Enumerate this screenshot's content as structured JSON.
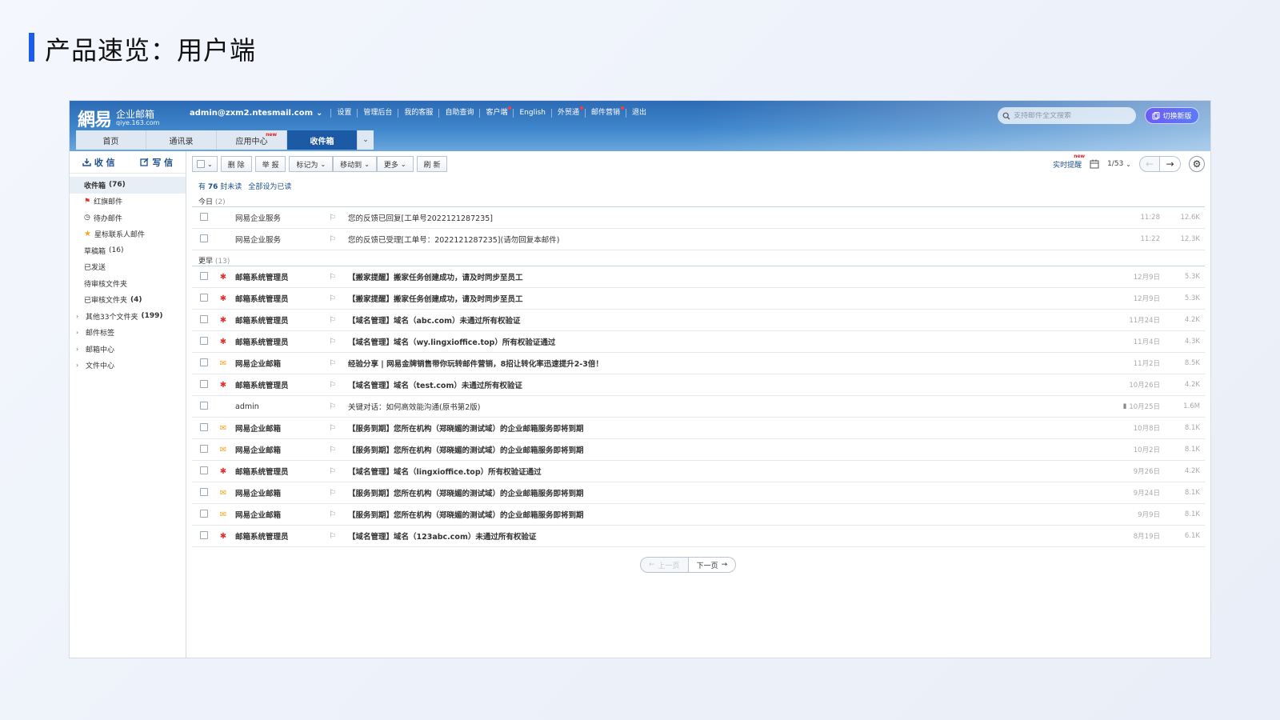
{
  "slide": {
    "title": "产品速览：用户端"
  },
  "header": {
    "logo_mark": "網易",
    "logo_name": "企业邮箱",
    "logo_domain": "qiye.163.com",
    "account": "admin@zxm2.ntesmail.com",
    "nav": [
      "设置",
      "管理后台",
      "我的客服",
      "自助查询",
      "客户端",
      "English",
      "外贸通",
      "邮件营销",
      "退出"
    ],
    "search_placeholder": "支持邮件全文搜索",
    "switch_label": "切换新版"
  },
  "tabs": [
    {
      "label": "首页"
    },
    {
      "label": "通讯录"
    },
    {
      "label": "应用中心",
      "badge": "new"
    },
    {
      "label": "收件箱"
    }
  ],
  "sidebar": {
    "receive": "收 信",
    "compose": "写 信",
    "items": [
      {
        "label": "收件箱",
        "count": "(76)"
      },
      {
        "label": "红旗邮件"
      },
      {
        "label": "待办邮件"
      },
      {
        "label": "星标联系人邮件"
      },
      {
        "label": "草稿箱",
        "count": "(16)"
      },
      {
        "label": "已发送"
      },
      {
        "label": "待审核文件夹"
      },
      {
        "label": "已审核文件夹",
        "count": "(4)"
      },
      {
        "label": "其他33个文件夹",
        "count": "(199)"
      },
      {
        "label": "邮件标签"
      },
      {
        "label": "邮箱中心"
      },
      {
        "label": "文件中心"
      }
    ]
  },
  "toolbar": {
    "delete": "删 除",
    "report": "举 报",
    "mark_as": "标记为",
    "move_to": "移动到",
    "more": "更多",
    "refresh": "刷 新",
    "realtime": "实时提醒",
    "realtime_badge": "new",
    "page": "1/53"
  },
  "unread": {
    "prefix": "有",
    "count": "76",
    "suffix": "封未读",
    "mark_all": "全部设为已读"
  },
  "groups": {
    "today": {
      "label": "今日",
      "count": "(2)"
    },
    "earlier": {
      "label": "更早",
      "count": "(13)"
    }
  },
  "mails_today": [
    {
      "from": "网易企业服务",
      "subject": "您的反馈已回复[工单号2022121287235]",
      "time": "11:28",
      "size": "12.6K",
      "icon": "none",
      "bold": false
    },
    {
      "from": "网易企业服务",
      "subject": "您的反馈已受理[工单号：2022121287235](请勿回复本邮件)",
      "time": "11:22",
      "size": "12.3K",
      "icon": "none",
      "bold": false
    }
  ],
  "mails_earlier": [
    {
      "from": "邮箱系统管理员",
      "subject": "【搬家提醒】搬家任务创建成功，请及时同步至员工",
      "time": "12月9日",
      "size": "5.3K",
      "icon": "admin",
      "bold": true
    },
    {
      "from": "邮箱系统管理员",
      "subject": "【搬家提醒】搬家任务创建成功，请及时同步至员工",
      "time": "12月9日",
      "size": "5.3K",
      "icon": "admin",
      "bold": true
    },
    {
      "from": "邮箱系统管理员",
      "subject": "【域名管理】域名（abc.com）未通过所有权验证",
      "time": "11月24日",
      "size": "4.2K",
      "icon": "admin",
      "bold": true
    },
    {
      "from": "邮箱系统管理员",
      "subject": "【域名管理】域名（wy.lingxioffice.top）所有权验证通过",
      "time": "11月4日",
      "size": "4.3K",
      "icon": "admin",
      "bold": true
    },
    {
      "from": "网易企业邮箱",
      "subject": "经验分享 | 网易金牌销售带你玩转邮件营销，8招让转化率迅速提升2-3倍！",
      "time": "11月2日",
      "size": "8.5K",
      "icon": "envelope",
      "bold": true
    },
    {
      "from": "邮箱系统管理员",
      "subject": "【域名管理】域名（test.com）未通过所有权验证",
      "time": "10月26日",
      "size": "4.2K",
      "icon": "admin",
      "bold": true
    },
    {
      "from": "admin",
      "subject": "关键对话：如何高效能沟通(原书第2版)",
      "time": "10月25日",
      "size": "1.6M",
      "icon": "none",
      "bold": false,
      "attachment": true
    },
    {
      "from": "网易企业邮箱",
      "subject": "【服务到期】您所在机构（郑晓媚的测试域）的企业邮箱服务即将到期",
      "time": "10月8日",
      "size": "8.1K",
      "icon": "envelope",
      "bold": true
    },
    {
      "from": "网易企业邮箱",
      "subject": "【服务到期】您所在机构（郑晓媚的测试域）的企业邮箱服务即将到期",
      "time": "10月2日",
      "size": "8.1K",
      "icon": "envelope",
      "bold": true
    },
    {
      "from": "邮箱系统管理员",
      "subject": "【域名管理】域名（lingxioffice.top）所有权验证通过",
      "time": "9月26日",
      "size": "4.2K",
      "icon": "admin",
      "bold": true
    },
    {
      "from": "网易企业邮箱",
      "subject": "【服务到期】您所在机构（郑晓媚的测试域）的企业邮箱服务即将到期",
      "time": "9月24日",
      "size": "8.1K",
      "icon": "envelope",
      "bold": true
    },
    {
      "from": "网易企业邮箱",
      "subject": "【服务到期】您所在机构（郑晓媚的测试域）的企业邮箱服务即将到期",
      "time": "9月9日",
      "size": "8.1K",
      "icon": "envelope",
      "bold": true
    },
    {
      "from": "邮箱系统管理员",
      "subject": "【域名管理】域名（123abc.com）未通过所有权验证",
      "time": "8月19日",
      "size": "6.1K",
      "icon": "admin",
      "bold": true
    }
  ],
  "pager": {
    "prev": "上一页",
    "next": "下一页"
  },
  "colors": {
    "accent": "#1a5cf0",
    "header_blue": "#2d6bb4",
    "active_tab": "#1d5aa5",
    "alert_red": "#e33030",
    "envelope_orange": "#f0a020"
  }
}
